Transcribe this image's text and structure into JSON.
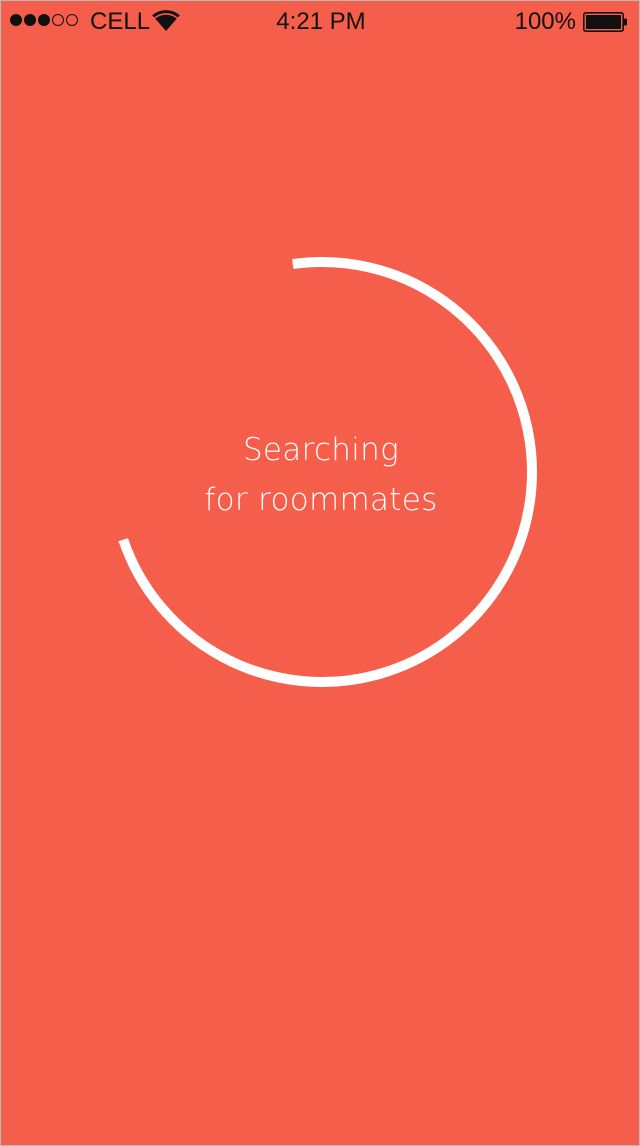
{
  "colors": {
    "background": "#f45e4a",
    "spinner": "#ffffff",
    "status_text": "#111111"
  },
  "status_bar": {
    "signal_strength": "3 of 5",
    "carrier": "CELL",
    "wifi_icon": "wifi-icon",
    "time": "4:21 PM",
    "battery_percent": "100%",
    "battery_level": 1.0,
    "battery_icon": "battery-icon"
  },
  "loading": {
    "line1": "Searching",
    "line2": "for roommates",
    "progress_fraction": 0.72,
    "spinner_icon": "loading-ring-icon"
  }
}
